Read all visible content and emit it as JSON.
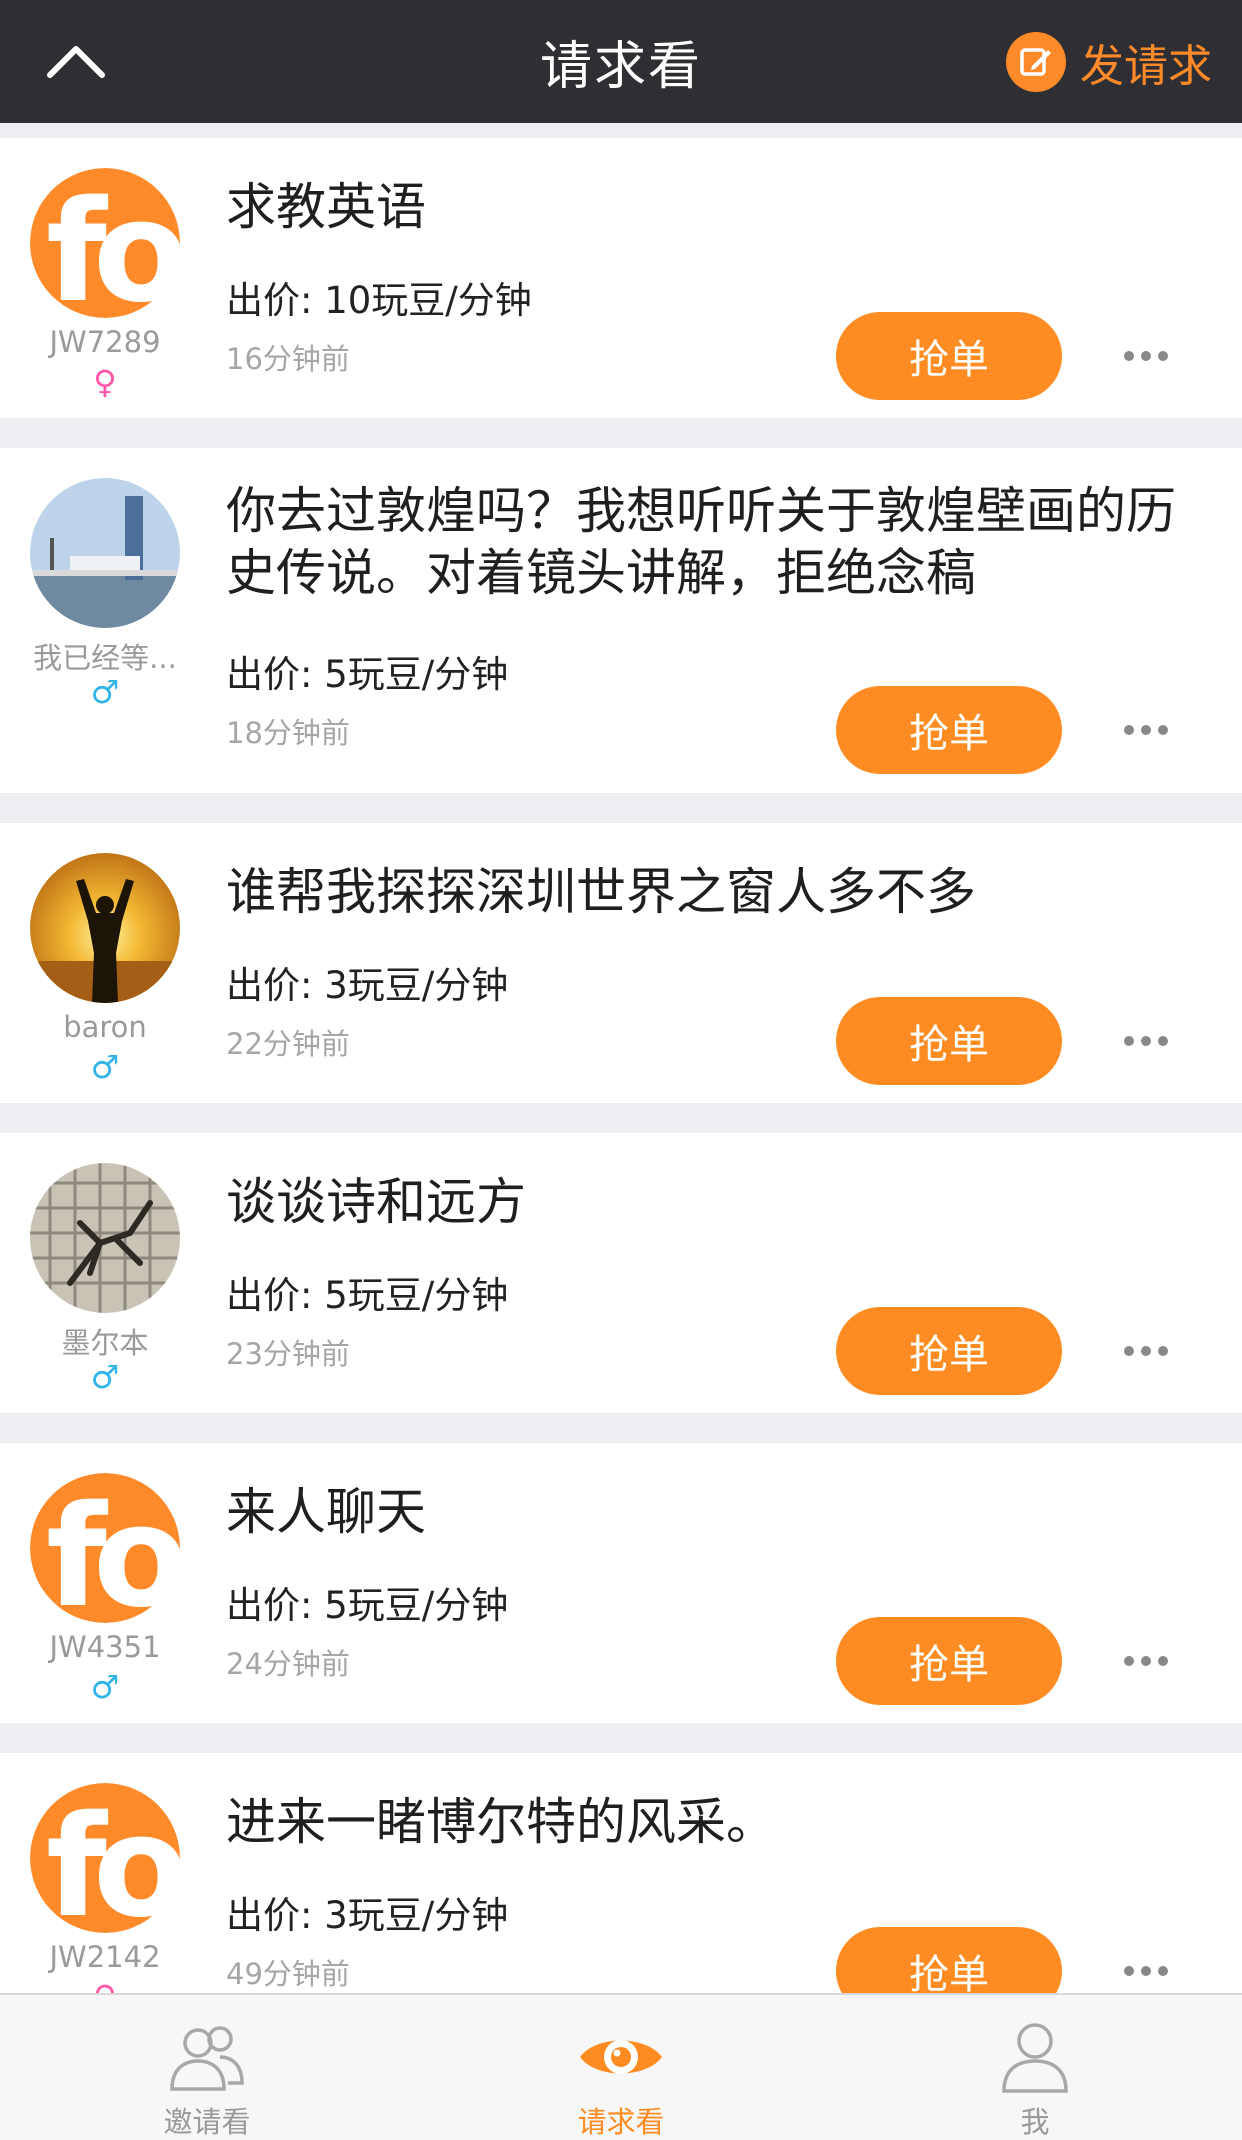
{
  "header": {
    "title": "请求看",
    "post_label": "发请求"
  },
  "requests": [
    {
      "user": "JW7289",
      "gender": "♀",
      "gender_type": "female",
      "avatar": "fo-logo",
      "title": "求教英语",
      "price": "出价: 10玩豆/分钟",
      "time": "16分钟前",
      "action": "抢单"
    },
    {
      "user": "我已经等...",
      "gender": "♂",
      "gender_type": "male",
      "avatar": "harbor-photo",
      "title": "你去过敦煌吗？我想听听关于敦煌壁画的历史传说。对着镜头讲解，拒绝念稿",
      "price": "出价: 5玩豆/分钟",
      "time": "18分钟前",
      "action": "抢单"
    },
    {
      "user": "baron",
      "gender": "♂",
      "gender_type": "male",
      "avatar": "sunset-photo",
      "title": "谁帮我探探深圳世界之窗人多不多",
      "price": "出价: 3玩豆/分钟",
      "time": "22分钟前",
      "action": "抢单"
    },
    {
      "user": "墨尔本",
      "gender": "♂",
      "gender_type": "male",
      "avatar": "scorpion-photo",
      "title": "谈谈诗和远方",
      "price": "出价: 5玩豆/分钟",
      "time": "23分钟前",
      "action": "抢单"
    },
    {
      "user": "JW4351",
      "gender": "♂",
      "gender_type": "male",
      "avatar": "fo-logo",
      "title": "来人聊天",
      "price": "出价: 5玩豆/分钟",
      "time": "24分钟前",
      "action": "抢单"
    },
    {
      "user": "JW2142",
      "gender": "♀",
      "gender_type": "female",
      "avatar": "fo-logo",
      "title": "进来一睹博尔特的风采。",
      "price": "出价: 3玩豆/分钟",
      "time": "49分钟前",
      "action": "抢单"
    }
  ],
  "tabs": [
    {
      "label": "邀请看",
      "icon": "users-icon",
      "active": false
    },
    {
      "label": "请求看",
      "icon": "eye-icon",
      "active": true
    },
    {
      "label": "我",
      "icon": "person-icon",
      "active": false
    }
  ],
  "colors": {
    "accent": "#ff8c22",
    "navbar": "#2f2f33",
    "female": "#ff56a8",
    "male": "#33b4e8"
  }
}
